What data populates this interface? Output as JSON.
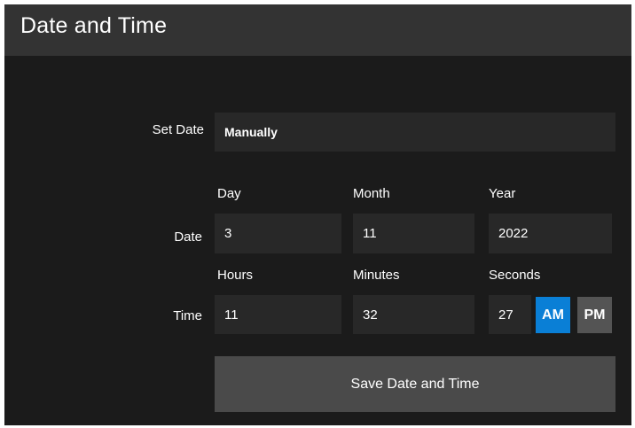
{
  "header": {
    "title": "Date and Time"
  },
  "set_date": {
    "label": "Set Date",
    "value": "Manually"
  },
  "date": {
    "row_label": "Date",
    "day_label": "Day",
    "month_label": "Month",
    "year_label": "Year",
    "day": "3",
    "month": "11",
    "year": "2022"
  },
  "time": {
    "row_label": "Time",
    "hours_label": "Hours",
    "minutes_label": "Minutes",
    "seconds_label": "Seconds",
    "hours": "11",
    "minutes": "32",
    "seconds": "27",
    "am_label": "AM",
    "pm_label": "PM",
    "selected_period": "AM"
  },
  "actions": {
    "save_label": "Save Date and Time"
  },
  "colors": {
    "panel_bg": "#1b1b1b",
    "header_bg": "#333333",
    "field_bg": "#282828",
    "am_active": "#0a7fd6",
    "pm_inactive": "#545454",
    "button_bg": "#4a4a4a"
  }
}
